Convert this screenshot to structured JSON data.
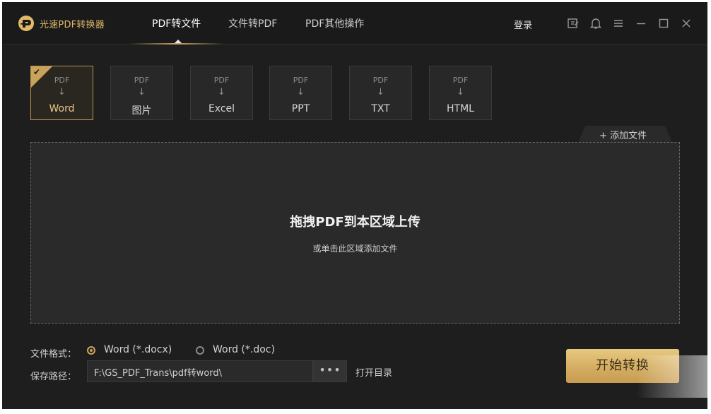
{
  "app": {
    "title": "光速PDF转换器",
    "accent_color": "#c9a35b"
  },
  "nav": {
    "tabs": [
      {
        "label": "PDF转文件",
        "active": true
      },
      {
        "label": "文件转PDF",
        "active": false
      },
      {
        "label": "PDF其他操作",
        "active": false
      }
    ]
  },
  "header": {
    "login_label": "登录",
    "icons": [
      "feedback-icon",
      "bell-icon",
      "menu-icon",
      "minimize-icon",
      "maximize-icon",
      "close-icon"
    ]
  },
  "formats": [
    {
      "source": "PDF",
      "target": "Word",
      "selected": true
    },
    {
      "source": "PDF",
      "target": "图片",
      "selected": false
    },
    {
      "source": "PDF",
      "target": "Excel",
      "selected": false
    },
    {
      "source": "PDF",
      "target": "PPT",
      "selected": false
    },
    {
      "source": "PDF",
      "target": "TXT",
      "selected": false
    },
    {
      "source": "PDF",
      "target": "HTML",
      "selected": false
    }
  ],
  "arrow_glyph": "↓",
  "add_file": {
    "icon": "+",
    "label": "添加文件"
  },
  "dropzone": {
    "title": "拖拽PDF到本区域上传",
    "subtitle": "或单击此区域添加文件"
  },
  "settings": {
    "format_label": "文件格式：",
    "format_options": [
      {
        "label": "Word (*.docx)",
        "selected": true
      },
      {
        "label": "Word (*.doc)",
        "selected": false
      }
    ],
    "save_path_label": "保存路径：",
    "save_path_value": "F:\\GS_PDF_Trans\\pdf转word\\",
    "browse_label": "•••",
    "open_dir_label": "打开目录"
  },
  "start_button_label": "开始转换"
}
